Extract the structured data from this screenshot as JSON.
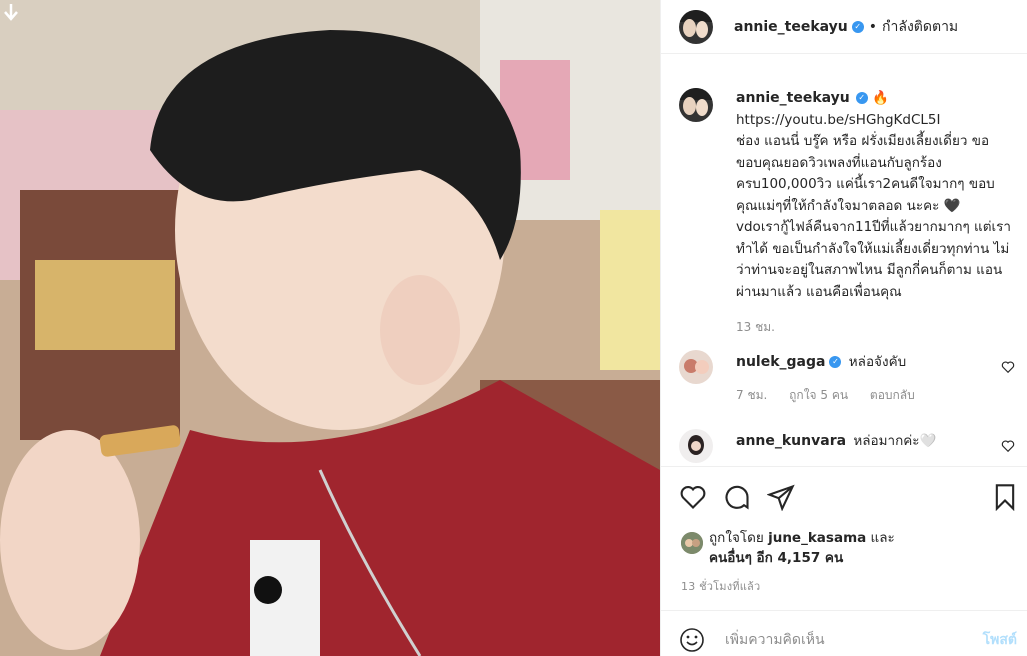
{
  "post": {
    "username": "annie_teekayu",
    "follow_label": "กำลังติดตาม",
    "caption_user": "annie_teekayu",
    "caption_emoji": "🔥",
    "caption_text": "https://youtu.be/sHGhgKdCL5I\nช่อง แอนนี่ บรู๊ค หรือ ฝรั่งเมียงเลี้ยงเดี่ยว ขอขอบคุณยอดวิวเพลงที่แอนกับลูกร้อง ครบ100,000วิว แค่นี้เรา2คนดีใจมากๆ ขอบคุณแม่ๆที่ให้กำลังใจมาตลอด นะคะ 🖤\nvdoเรากู้ไฟล์คืนจาก11ปีที่แล้วยากมากๆ แต่เราทำได้ ขอเป็นกำลังใจให้แม่เลี้ยงเดี่ยวทุกท่าน ไม่ว่าท่านจะอยู่ในสภาพไหน มีลูกกี่คนก็ตาม แอนผ่านมาแล้ว แอนคือเพื่อนคุณ",
    "caption_time": "13 ชม.",
    "comments": [
      {
        "user": "nulek_gaga",
        "text": "หล่อจังคับ",
        "time": "7 ชม.",
        "likes": "ถูกใจ 5 คน",
        "reply": "ตอบกลับ"
      },
      {
        "user": "anne_kunvara",
        "text": "หล่อมากค่ะ🤍"
      }
    ],
    "liked_by_prefix": "ถูกใจโดย",
    "liked_by_user": "june_kasama",
    "liked_by_and": "และ",
    "liked_others": "คนอื่นๆ อีก 4,157 คน",
    "time_ago": "13 ชั่วโมงที่แล้ว",
    "comment_placeholder": "เพิ่มความคิดเห็น",
    "post_button": "โพสต์"
  },
  "icons": {
    "header_download": "arrow-down-icon",
    "like": "heart-icon",
    "comment": "comment-bubble-icon",
    "share": "paper-plane-icon",
    "save": "bookmark-icon",
    "emoji": "smiley-icon"
  },
  "colors": {
    "verified": "#3897f0",
    "muted": "#8e8e8e",
    "post_disabled": "#b2dffc"
  }
}
